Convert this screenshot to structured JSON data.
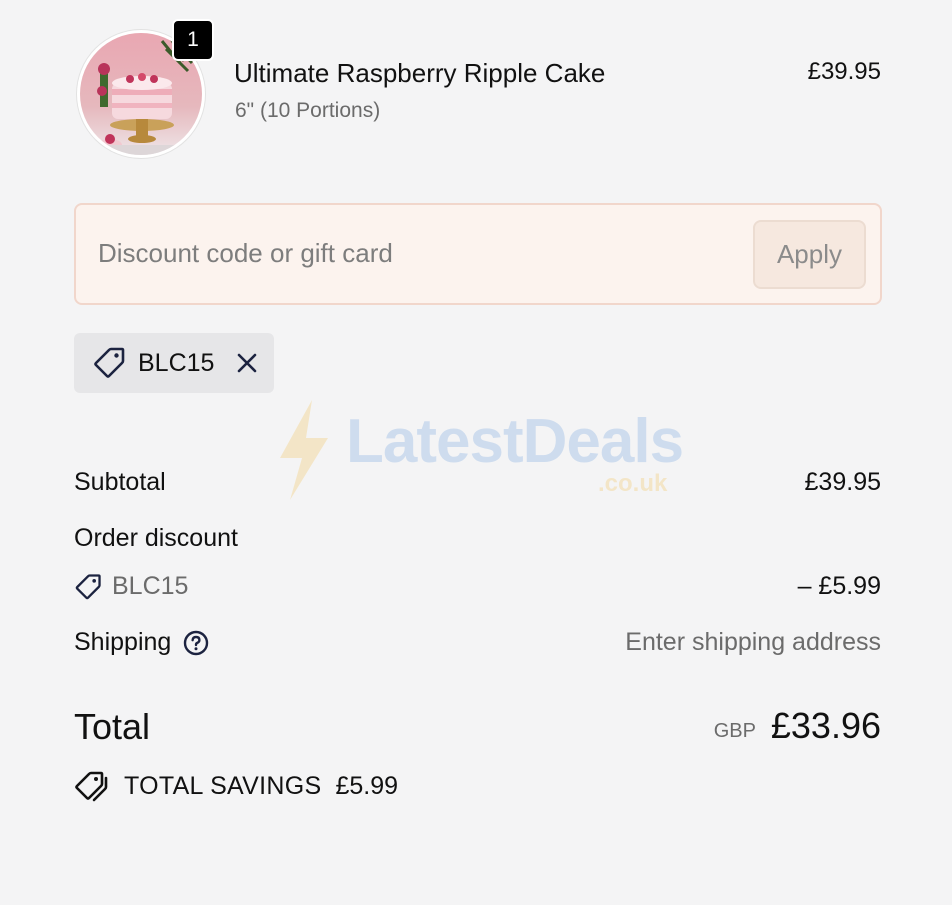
{
  "product": {
    "quantity": "1",
    "title": "Ultimate Raspberry Ripple Cake",
    "variant": "6\" (10 Portions)",
    "price": "£39.95"
  },
  "discount": {
    "placeholder": "Discount code or gift card",
    "value": "",
    "apply_label": "Apply",
    "applied_code": "BLC15"
  },
  "summary": {
    "subtotal_label": "Subtotal",
    "subtotal_value": "£39.95",
    "order_discount_label": "Order discount",
    "discount_code": "BLC15",
    "discount_value": "– £5.99",
    "shipping_label": "Shipping",
    "shipping_value": "Enter shipping address",
    "total_label": "Total",
    "total_currency": "GBP",
    "total_value": "£33.96",
    "savings_label": "TOTAL SAVINGS",
    "savings_value": "£5.99"
  },
  "watermark": {
    "brand": "LatestDeals",
    "domain": ".co.uk"
  },
  "icons": {
    "tag": "tag-icon",
    "remove": "close-icon",
    "help": "question-circle-icon",
    "savings": "tags-icon",
    "watermark": "lightning-bolt-icon"
  },
  "colors": {
    "page_background": "#f4f4f5",
    "discount_box_background": "#fcf3ee",
    "discount_box_border": "#f1d6cb",
    "chip_background": "#e6e6e8",
    "icon_navy": "#1c2340",
    "muted_text": "#6b6b6b"
  }
}
